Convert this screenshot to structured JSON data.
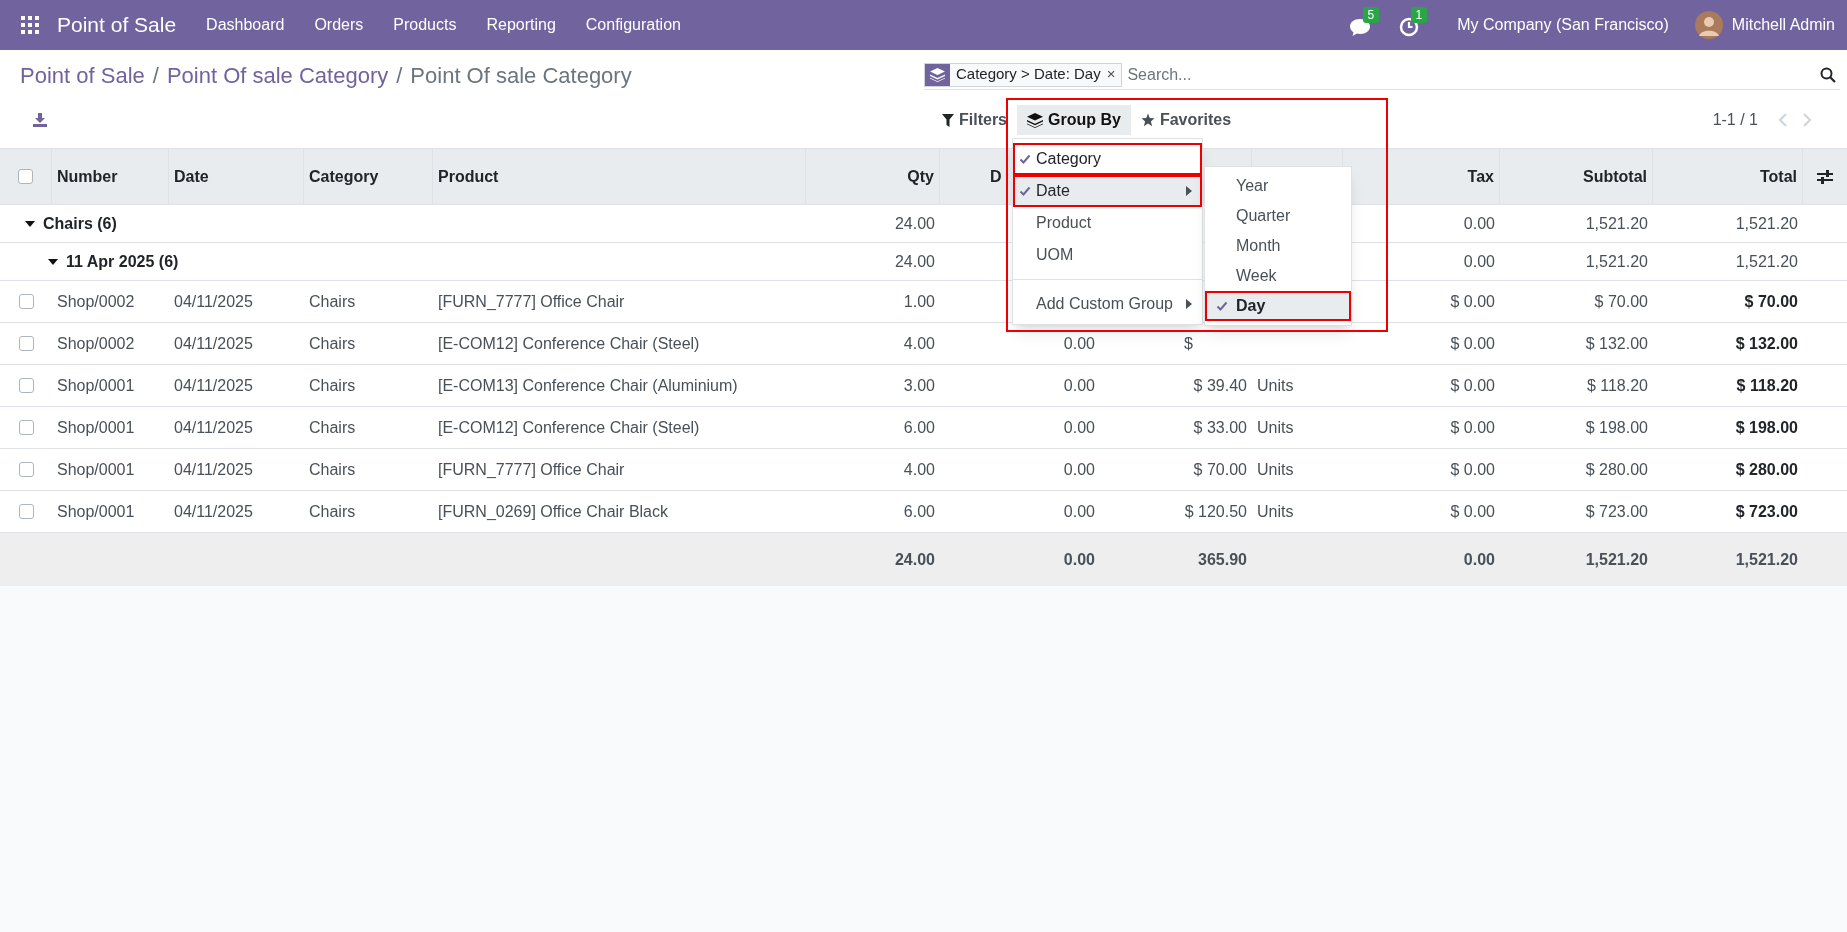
{
  "navbar": {
    "app_name": "Point of Sale",
    "menu": [
      "Dashboard",
      "Orders",
      "Products",
      "Reporting",
      "Configuration"
    ],
    "messages_badge": "5",
    "activities_badge": "1",
    "company": "My Company (San Francisco)",
    "user": "Mitchell Admin"
  },
  "breadcrumb": [
    {
      "kind": "link",
      "label": "Point of Sale"
    },
    {
      "kind": "separator",
      "label": "/"
    },
    {
      "kind": "link",
      "label": "Point Of sale Category"
    },
    {
      "kind": "separator",
      "label": "/"
    },
    {
      "kind": "current",
      "label": "Point Of sale Category"
    }
  ],
  "search": {
    "facet": {
      "label": "Category > Date: Day",
      "remove": "×"
    },
    "placeholder": "Search..."
  },
  "toolbar": {
    "buttons": [
      {
        "kind": "filters",
        "label": "Filters",
        "selected": false
      },
      {
        "kind": "groupby",
        "label": "Group By",
        "selected": true
      },
      {
        "kind": "favorites",
        "label": "Favorites",
        "selected": false
      }
    ],
    "pager": "1-1 / 1"
  },
  "group_by_menu": {
    "items": [
      {
        "label": "Category",
        "checked": true,
        "outlined": true,
        "kind": "option",
        "active": false
      },
      {
        "label": "Date",
        "checked": true,
        "outlined": true,
        "kind": "submenu",
        "active": true
      },
      {
        "label": "Product",
        "checked": false,
        "outlined": false,
        "kind": "option",
        "active": false
      },
      {
        "label": "UOM",
        "checked": false,
        "outlined": false,
        "kind": "option",
        "active": false
      },
      {
        "label": "Add Custom Group",
        "checked": false,
        "outlined": false,
        "kind": "custom",
        "active": false
      }
    ],
    "submenu": [
      {
        "label": "Year",
        "checked": false,
        "outlined": false
      },
      {
        "label": "Quarter",
        "checked": false,
        "outlined": false
      },
      {
        "label": "Month",
        "checked": false,
        "outlined": false
      },
      {
        "label": "Week",
        "checked": false,
        "outlined": false
      },
      {
        "label": "Day",
        "checked": true,
        "outlined": true
      }
    ]
  },
  "table": {
    "all_selected": false,
    "header": {
      "number": "Number",
      "date": "Date",
      "category": "Category",
      "product": "Product",
      "qty": "Qty",
      "column_6": "D",
      "tax": "Tax",
      "subtotal": "Subtotal",
      "total": "Total",
      "column_6_cut": true
    },
    "groups": [
      {
        "label": "Chairs (6)",
        "expanded": true,
        "qty": "24.00",
        "tax": "0.00",
        "subtotal": "1,521.20",
        "total": "1,521.20",
        "children": [
          {
            "label": "11 Apr 2025 (6)",
            "expanded": true,
            "qty": "24.00",
            "tax": "0.00",
            "subtotal": "1,521.20",
            "total": "1,521.20",
            "records": [
              {
                "selected": false,
                "number": "Shop/0002",
                "date": "04/11/2025",
                "category": "Chairs",
                "product": "[FURN_7777] Office Chair",
                "qty": "1.00",
                "tax": "$ 0.00",
                "subtotal": "$ 70.00",
                "total": "$ 70.00"
              },
              {
                "selected": false,
                "number": "Shop/0002",
                "date": "04/11/2025",
                "category": "Chairs",
                "product": "[E-COM12] Conference Chair (Steel)",
                "qty": "4.00",
                "column_6": "0.00",
                "column_7": "$",
                "tax": "$ 0.00",
                "subtotal": "$ 132.00",
                "total": "$ 132.00",
                "column_7_cut": true
              },
              {
                "selected": false,
                "number": "Shop/0001",
                "date": "04/11/2025",
                "category": "Chairs",
                "product": "[E-COM13] Conference Chair (Aluminium)",
                "qty": "3.00",
                "column_6": "0.00",
                "column_7": "$ 39.40",
                "column_8": "Units",
                "tax": "$ 0.00",
                "subtotal": "$ 118.20",
                "total": "$ 118.20"
              },
              {
                "selected": false,
                "number": "Shop/0001",
                "date": "04/11/2025",
                "category": "Chairs",
                "product": "[E-COM12] Conference Chair (Steel)",
                "qty": "6.00",
                "column_6": "0.00",
                "column_7": "$ 33.00",
                "column_8": "Units",
                "tax": "$ 0.00",
                "subtotal": "$ 198.00",
                "total": "$ 198.00"
              },
              {
                "selected": false,
                "number": "Shop/0001",
                "date": "04/11/2025",
                "category": "Chairs",
                "product": "[FURN_7777] Office Chair",
                "qty": "4.00",
                "column_6": "0.00",
                "column_7": "$ 70.00",
                "column_8": "Units",
                "tax": "$ 0.00",
                "subtotal": "$ 280.00",
                "total": "$ 280.00"
              },
              {
                "selected": false,
                "number": "Shop/0001",
                "date": "04/11/2025",
                "category": "Chairs",
                "product": "[FURN_0269] Office Chair Black",
                "qty": "6.00",
                "column_6": "0.00",
                "column_7": "$ 120.50",
                "column_8": "Units",
                "tax": "$ 0.00",
                "subtotal": "$ 723.00",
                "total": "$ 723.00"
              }
            ]
          }
        ]
      }
    ],
    "totals": {
      "qty": "24.00",
      "column_6": "0.00",
      "column_7": "365.90",
      "tax": "0.00",
      "subtotal": "1,521.20",
      "total": "1,521.20"
    }
  }
}
